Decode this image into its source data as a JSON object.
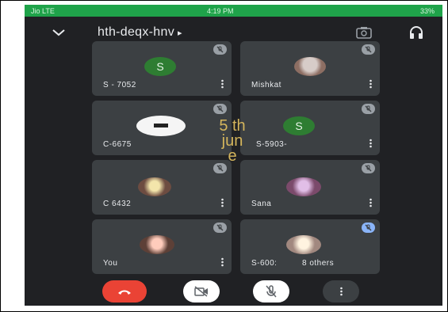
{
  "statusbar": {
    "carrier": "Jio  LTE",
    "time": "4:19 PM",
    "battery": "33%"
  },
  "topbar": {
    "meeting_code": "hth-deqx-hnv",
    "arrow": "▸"
  },
  "tiles": [
    {
      "name": "S - 7052",
      "avatar_letter": "S"
    },
    {
      "name": "Mishkat"
    },
    {
      "name": "C-6675"
    },
    {
      "name": "S-5903-",
      "avatar_letter": "S"
    },
    {
      "name": "C 6432"
    },
    {
      "name": "Sana"
    },
    {
      "name": "You"
    },
    {
      "name": "S-600:",
      "others_label": "8 others"
    }
  ],
  "overlay": {
    "line1": "5 th",
    "line2": "jun",
    "line3": "e"
  },
  "colors": {
    "phone_bg": "#202124",
    "tile_bg": "#3c4043",
    "status_green": "#1fa34a",
    "end_call": "#ea4335",
    "date_overlay": "#d4b55c"
  }
}
